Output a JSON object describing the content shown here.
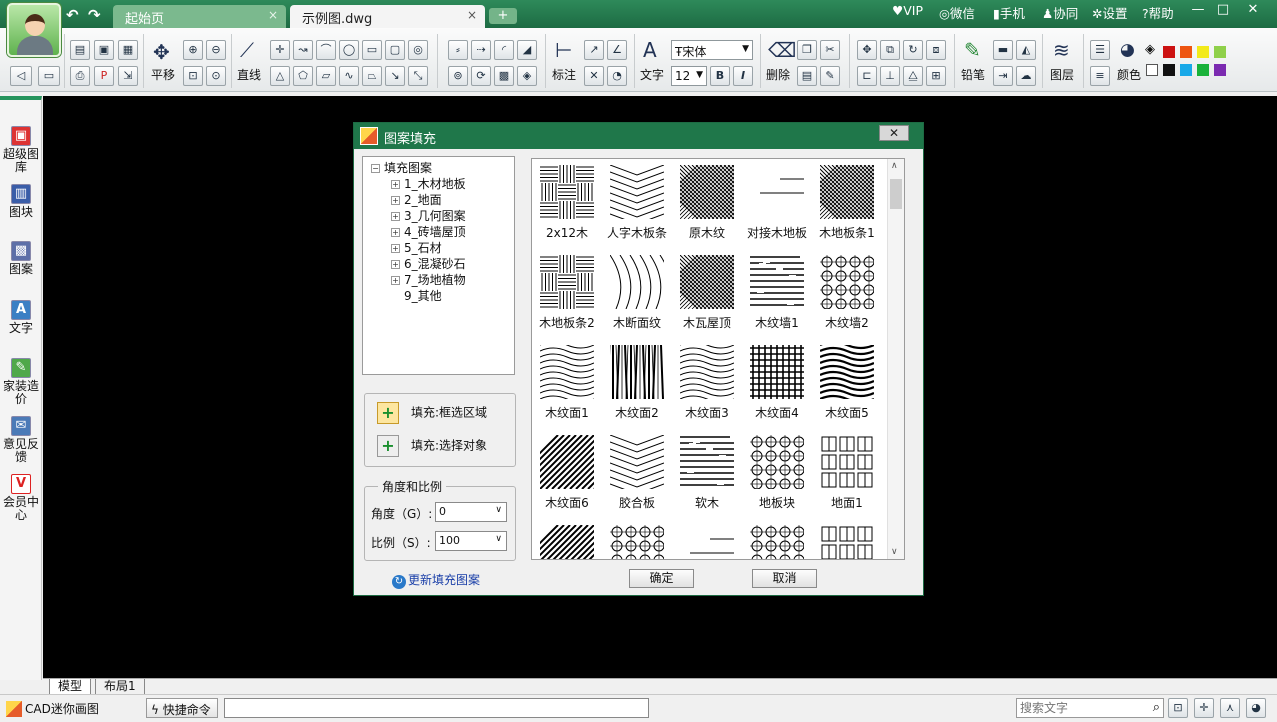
{
  "titlebar": {
    "tabs": [
      {
        "label": "起始页",
        "close": "×"
      },
      {
        "label": "示例图.dwg",
        "close": "×"
      }
    ],
    "add_tab": "+",
    "menu": [
      {
        "icon": "♥",
        "label": "VIP"
      },
      {
        "icon": "◎",
        "label": "微信"
      },
      {
        "icon": "▮",
        "label": "手机"
      },
      {
        "icon": "♟",
        "label": "协同"
      },
      {
        "icon": "✲",
        "label": "设置"
      },
      {
        "icon": "?",
        "label": "帮助"
      }
    ],
    "window_buttons": {
      "minimize": "—",
      "maximize": "□",
      "close": "✕"
    }
  },
  "toolbar": {
    "pan": "平移",
    "line": "直线",
    "dim": "标注",
    "text": "文字",
    "font": "宋体",
    "font_size": "12",
    "bold": "B",
    "italic": "I",
    "delete": "删除",
    "pencil": "铅笔",
    "layer": "图层",
    "color": "颜色",
    "swatches": [
      "#cc1111",
      "#ee5511",
      "#f2ea1a",
      "#8fd04a",
      "#ffffff",
      "#111111",
      "#19a9e8",
      "#1ab23a",
      "#7b2ab0"
    ]
  },
  "leftpanel": [
    {
      "label": "超级图库"
    },
    {
      "label": "图块"
    },
    {
      "label": "图案"
    },
    {
      "label": "文字"
    },
    {
      "label": "家装造价"
    },
    {
      "label": "意见反馈"
    },
    {
      "label": "会员中心"
    }
  ],
  "dialog": {
    "title": "图案填充",
    "close": "✕",
    "tree": {
      "root": "填充图案",
      "items": [
        "1_木材地板",
        "2_地面",
        "3_几何图案",
        "4_砖墙屋顶",
        "5_石材",
        "6_混凝砂石",
        "7_场地植物",
        "9_其他"
      ]
    },
    "fill_region": "填充:框选区域",
    "fill_object": "填充:选择对象",
    "angle_group": "角度和比例",
    "angle_label": "角度（G）:",
    "angle_value": "0",
    "scale_label": "比例（S）:",
    "scale_value": "100",
    "update": "更新填充图案",
    "ok": "确定",
    "cancel": "取消",
    "patterns": [
      "2x12木",
      "人字木板条",
      "原木纹",
      "对接木地板",
      "木地板条1",
      "木地板条2",
      "木断面纹",
      "木瓦屋顶",
      "木纹墙1",
      "木纹墙2",
      "木纹面1",
      "木纹面2",
      "木纹面3",
      "木纹面4",
      "木纹面5",
      "木纹面6",
      "胶合板",
      "软木",
      "地板块",
      "地面1"
    ]
  },
  "layout_tabs": [
    "模型",
    "布局1"
  ],
  "status": {
    "app": "CAD迷你画图",
    "quick_cmd": "快捷命令",
    "search_placeholder": "搜索文字"
  }
}
